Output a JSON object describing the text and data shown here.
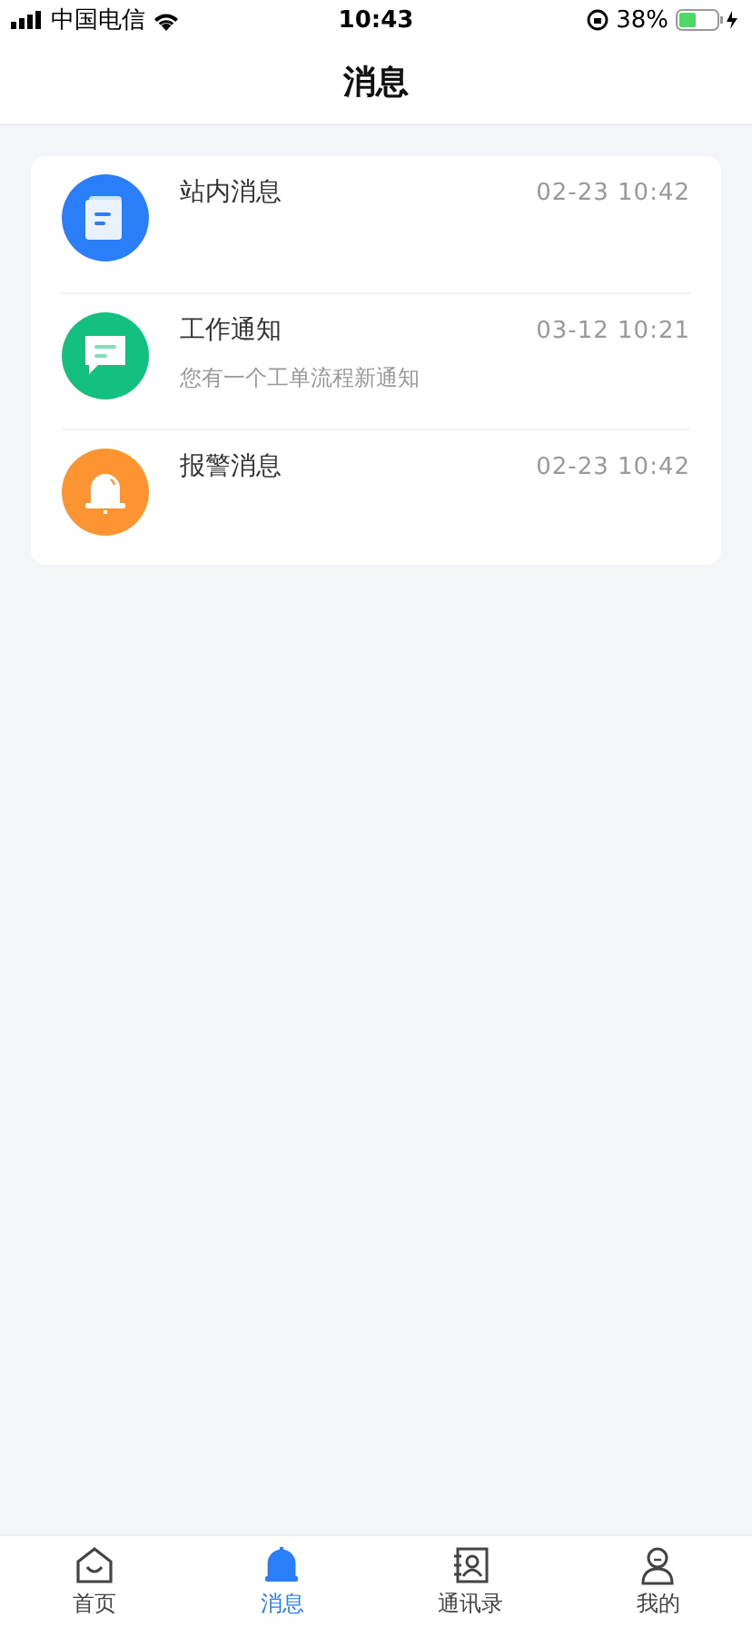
{
  "status_bar": {
    "carrier": "中国电信",
    "time": "10:43",
    "battery": "38%"
  },
  "header": {
    "title": "消息"
  },
  "messages": [
    {
      "kind": "notice",
      "color": "#2a7ef8",
      "title": "站内消息",
      "time": "02-23 10:42"
    },
    {
      "kind": "chat",
      "color": "#14c07f",
      "title": "工作通知",
      "time": "03-12 10:21",
      "preview": "您有一个工单流程新通知"
    },
    {
      "kind": "alarm",
      "color": "#fd9432",
      "title": "报警消息",
      "time": "02-23 10:42"
    }
  ],
  "tabs": [
    {
      "kind": "home",
      "label": "首页",
      "selected": false
    },
    {
      "kind": "bell",
      "label": "消息",
      "selected": true
    },
    {
      "kind": "contacts",
      "label": "通讯录",
      "selected": false
    },
    {
      "kind": "user",
      "label": "我的",
      "selected": false
    }
  ]
}
